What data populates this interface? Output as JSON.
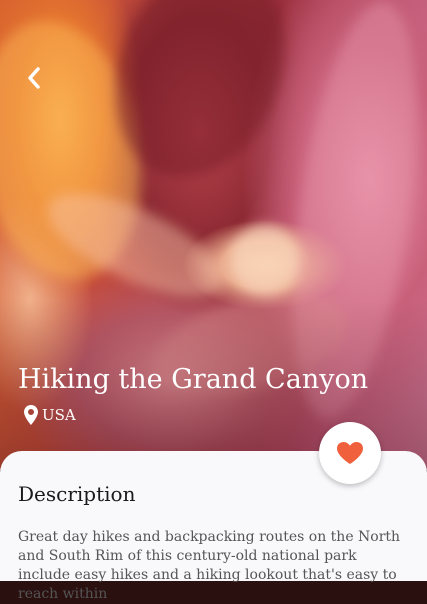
{
  "trail": {
    "title": "Hiking the Grand Canyon",
    "location": "USA"
  },
  "description": {
    "heading": "Description",
    "text": "Great day hikes and backpacking routes on the North and South Rim of this century-old national park include easy hikes and a hiking lookout that's easy to reach within"
  },
  "icons": {
    "back": "chevron-left-icon",
    "location": "map-pin-icon",
    "favorite": "heart-icon"
  },
  "colors": {
    "favorite": "#f0603d",
    "sheet": "#f9f9fb",
    "heading_text": "#1a1a1a",
    "body_text": "#555555"
  }
}
